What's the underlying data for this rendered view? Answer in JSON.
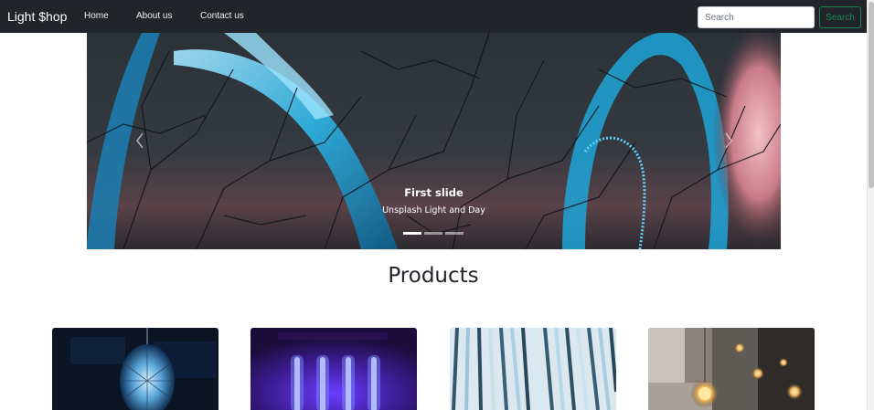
{
  "navbar": {
    "brand": "Light $hop",
    "links": [
      "Home",
      "About us",
      "Contact us"
    ],
    "search_placeholder": "Search",
    "search_button": "Search"
  },
  "carousel": {
    "prev_icon": "chevron-left-icon",
    "next_icon": "chevron-right-icon",
    "caption_title": "First slide",
    "caption_text": "Unsplash Light and Day",
    "indicator_count": 3,
    "active_indicator": 0
  },
  "products": {
    "title": "Products",
    "images": [
      "lantern-photo",
      "neon-tubes-photo",
      "light-tubes-photo",
      "bulbs-cafe-photo"
    ]
  },
  "colors": {
    "navbar_bg": "#212529",
    "search_outline": "#198754"
  }
}
